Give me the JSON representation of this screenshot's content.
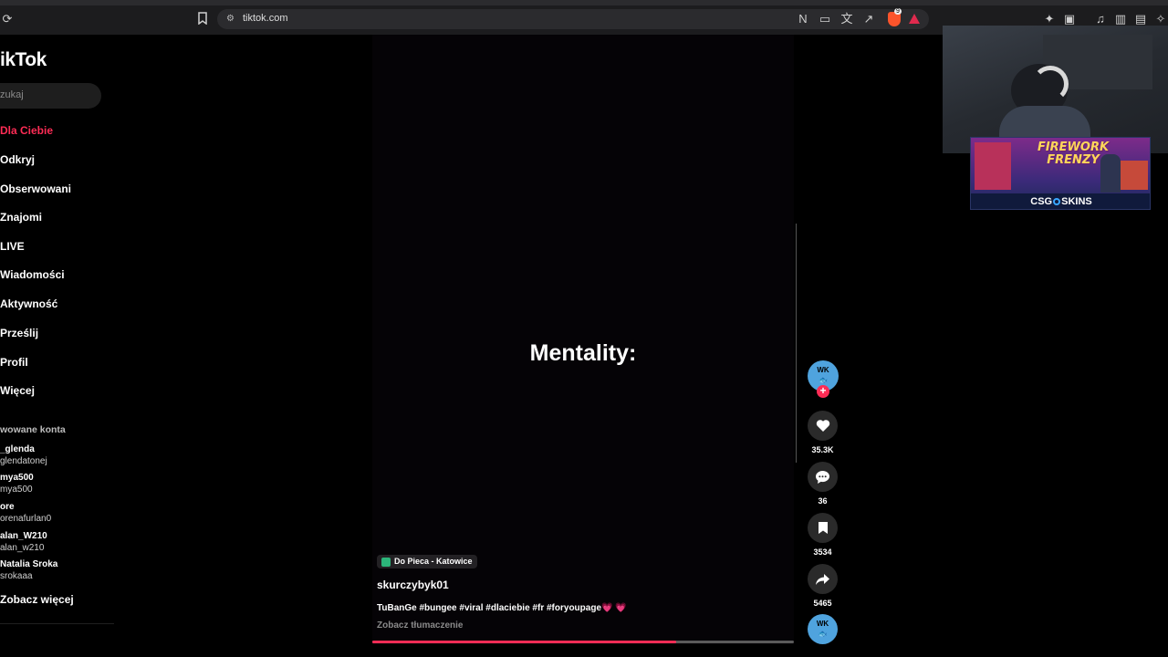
{
  "browser": {
    "url": "tiktok.com"
  },
  "sidebar": {
    "logo": "ikTok",
    "search_placeholder": "zukaj",
    "nav": [
      {
        "label": "Dla Ciebie",
        "active": true
      },
      {
        "label": "Odkryj"
      },
      {
        "label": "Obserwowani"
      },
      {
        "label": "Znajomi"
      },
      {
        "label": "LIVE"
      },
      {
        "label": "Wiadomości"
      },
      {
        "label": "Aktywność"
      },
      {
        "label": "Prześlij"
      },
      {
        "label": "Profil"
      },
      {
        "label": "Więcej"
      }
    ],
    "followed_title": "wowane konta",
    "accounts": [
      {
        "name": "_glenda",
        "handle": "glendatonej"
      },
      {
        "name": "mya500",
        "handle": "mya500"
      },
      {
        "name": "ore",
        "handle": "orenafurlan0"
      },
      {
        "name": "alan_W210",
        "handle": "alan_w210"
      },
      {
        "name": "Natalia Sroka",
        "handle": "srokaaa"
      }
    ],
    "see_more": "Zobacz więcej"
  },
  "video": {
    "overlay_text": "Mentality:",
    "location": "Do Pieca - Katowice",
    "author": "skurczybyk01",
    "caption": "TuBanGe #bungee #viral #dlaciebie #fr #foryoupage💗 💗",
    "translate": "Zobacz tłumaczenie",
    "progress": 0.72
  },
  "actions": {
    "avatar_text": "WK",
    "follow_symbol": "+",
    "likes": "35.3K",
    "comments": "36",
    "saves": "3534",
    "shares": "5465"
  },
  "overlay_ad": {
    "title_line1": "FIREWORK",
    "title_line2": "FRENZY",
    "brand_left": "CSG",
    "brand_right": "SKINS"
  },
  "colors": {
    "accent": "#fe2c55",
    "avatar_bg": "#4fa3de"
  }
}
